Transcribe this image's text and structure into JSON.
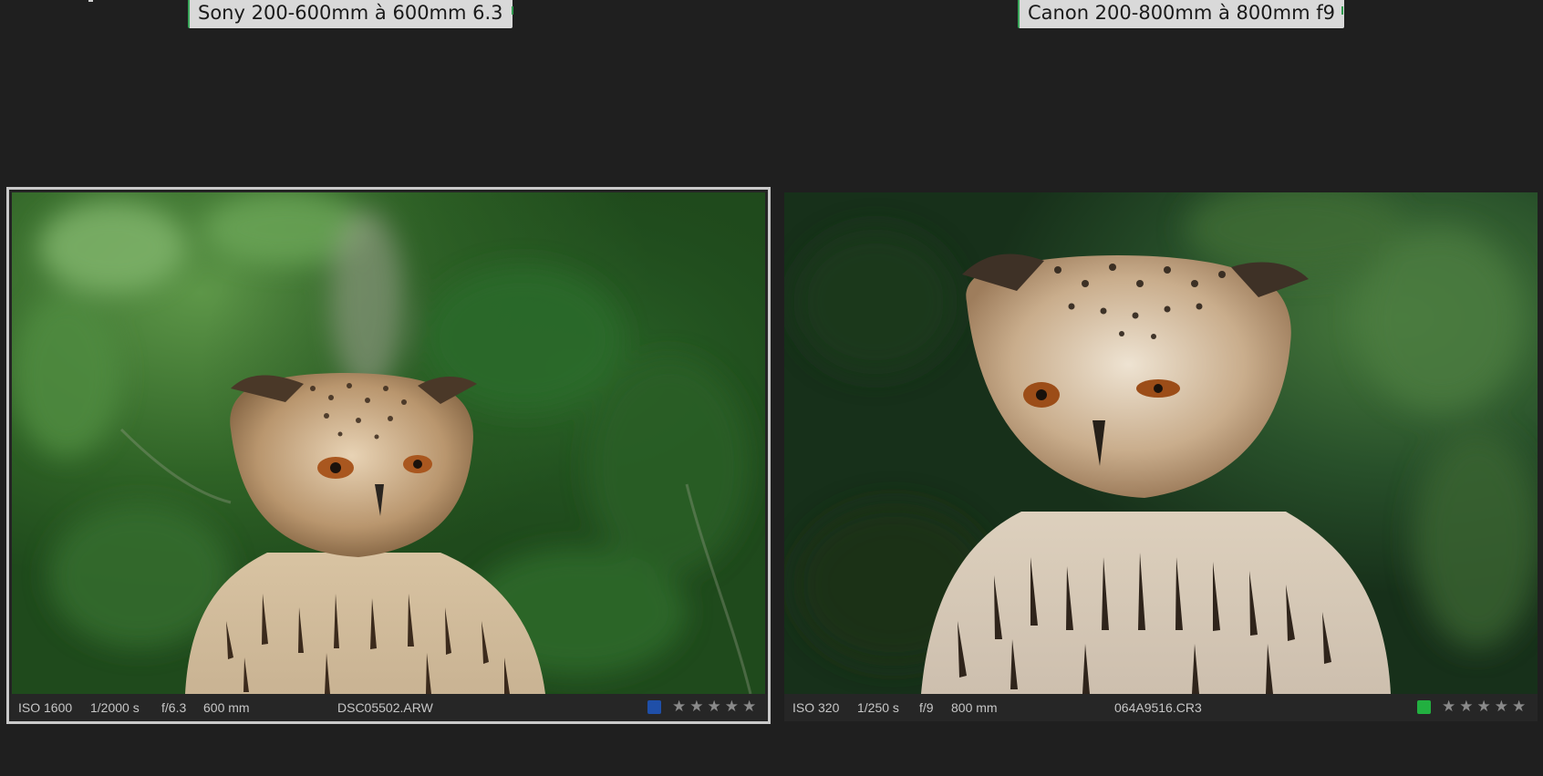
{
  "panels": [
    {
      "title": "Sony 200-600mm à 600mm 6.3",
      "iso": "ISO 1600",
      "shutter": "1/2000 s",
      "aperture": "f/6.3",
      "focal": "600 mm",
      "filename": "DSC05502.ARW",
      "color_label": "#1f4fa8",
      "rating_stars": "★★★★★",
      "rating": 0,
      "selected": true
    },
    {
      "title": "Canon 200-800mm à 800mm f9",
      "iso": "ISO 320",
      "shutter": "1/250 s",
      "aperture": "f/9",
      "focal": "800 mm",
      "filename": "064A9516.CR3",
      "color_label": "#22b040",
      "rating_stars": "★★★★★",
      "rating": 0,
      "selected": false
    }
  ]
}
